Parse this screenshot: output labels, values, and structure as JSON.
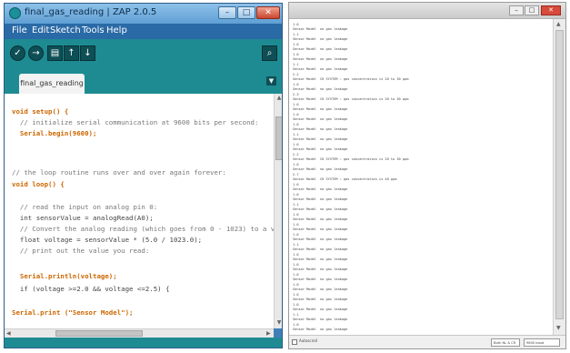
{
  "ide": {
    "title": "final_gas_reading | ZAP 2.0.5",
    "menu": [
      "File",
      "Edit",
      "Sketch",
      "Tools",
      "Help"
    ],
    "toolbar_icons": [
      "verify-icon",
      "upload-icon",
      "new-icon",
      "open-icon",
      "save-icon",
      "serial-monitor-icon"
    ],
    "tab_label": "final_gas_reading",
    "code_lines": [
      "",
      "void setup() {",
      "  // initialize serial communication at 9600 bits per second:",
      "  Serial.begin(9600);",
      "",
      "",
      "",
      "// the loop routine runs over and over again forever:",
      "void loop() {",
      "",
      "  // read the input on analog pin 0:",
      "  int sensorValue = analogRead(A0);",
      "  // Convert the analog reading (which goes from 0 - 1023) to a vo",
      "  float voltage = sensorValue * (5.0 / 1023.0);",
      "  // print out the value you read:",
      "",
      "  Serial.println(voltage);",
      "  if (voltage >=2.0 && voltage <=2.5) {",
      "",
      "Serial.print (\"Sensor Model\");"
    ]
  },
  "serial_monitor": {
    "rows": [
      {
        "value": "1.0",
        "label": "Sensor Model",
        "message": "no gas leakage"
      },
      {
        "value": "1.1",
        "label": "Sensor Model",
        "message": "no gas leakage"
      },
      {
        "value": "1.0",
        "label": "Sensor Model",
        "message": "no gas leakage"
      },
      {
        "value": "1.0",
        "label": "Sensor Model",
        "message": "no gas leakage"
      },
      {
        "value": "1.1",
        "label": "Sensor Model",
        "message": "no gas leakage"
      },
      {
        "value": "2.2",
        "label": "Sensor Model",
        "message": "CH SYSTEM : gas concentration is 20 to 30 ppm"
      },
      {
        "value": "1.0",
        "label": "Sensor Model",
        "message": "no gas leakage"
      },
      {
        "value": "2.3",
        "label": "Sensor Model",
        "message": "CH SYSTEM : gas concentration is 20 to 30 ppm"
      },
      {
        "value": "1.0",
        "label": "Sensor Model",
        "message": "no gas leakage"
      },
      {
        "value": "1.0",
        "label": "Sensor Model",
        "message": "no gas leakage"
      },
      {
        "value": "1.0",
        "label": "Sensor Model",
        "message": "no gas leakage"
      },
      {
        "value": "1.1",
        "label": "Sensor Model",
        "message": "no gas leakage"
      },
      {
        "value": "1.0",
        "label": "Sensor Model",
        "message": "no gas leakage"
      },
      {
        "value": "2.2",
        "label": "Sensor Model",
        "message": "CH SYSTEM : gas concentration is 20 to 30 ppm"
      },
      {
        "value": "1.0",
        "label": "Sensor Model",
        "message": "no gas leakage"
      },
      {
        "value": "2.7",
        "label": "Sensor Model",
        "message": "CH SYSTEM : gas concentration is 40 ppm"
      },
      {
        "value": "1.0",
        "label": "Sensor Model",
        "message": "no gas leakage"
      },
      {
        "value": "1.0",
        "label": "Sensor Model",
        "message": "no gas leakage"
      },
      {
        "value": "1.1",
        "label": "Sensor Model",
        "message": "no gas leakage"
      },
      {
        "value": "1.0",
        "label": "Sensor Model",
        "message": "no gas leakage"
      },
      {
        "value": "1.0",
        "label": "Sensor Model",
        "message": "no gas leakage"
      },
      {
        "value": "1.0",
        "label": "Sensor Model",
        "message": "no gas leakage"
      },
      {
        "value": "1.1",
        "label": "Sensor Model",
        "message": "no gas leakage"
      },
      {
        "value": "1.0",
        "label": "Sensor Model",
        "message": "no gas leakage"
      },
      {
        "value": "1.0",
        "label": "Sensor Model",
        "message": "no gas leakage"
      },
      {
        "value": "1.0",
        "label": "Sensor Model",
        "message": "no gas leakage"
      },
      {
        "value": "1.0",
        "label": "Sensor Model",
        "message": "no gas leakage"
      },
      {
        "value": "1.0",
        "label": "Sensor Model",
        "message": "no gas leakage"
      },
      {
        "value": "1.0",
        "label": "Sensor Model",
        "message": "no gas leakage"
      },
      {
        "value": "1.1",
        "label": "Sensor Model",
        "message": "no gas leakage"
      },
      {
        "value": "1.0",
        "label": "Sensor Model",
        "message": "no gas leakage"
      }
    ],
    "autoscroll_label": "Autoscroll",
    "line_ending": "Both NL & CR",
    "baud_rate": "9600 baud"
  }
}
